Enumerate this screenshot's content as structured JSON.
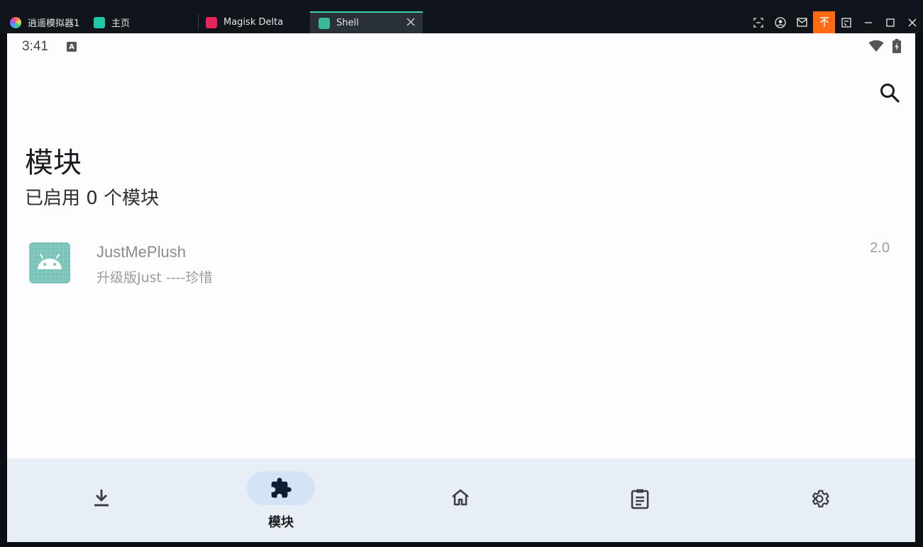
{
  "titlebar": {
    "tabs": [
      {
        "label": "逍遥模拟器1"
      },
      {
        "label": "主页"
      },
      {
        "label": "Magisk Delta"
      },
      {
        "label": "Shell"
      }
    ],
    "accent_color": "#ff6a13",
    "active_tab_color": "#39d3b0"
  },
  "status": {
    "time": "3:41",
    "badge": "A"
  },
  "page": {
    "title": "模块",
    "subtitle": "已启用 0 个模块"
  },
  "modules": [
    {
      "name": "JustMePlush",
      "description": "升级版Just  ----珍惜",
      "version": "2.0"
    }
  ],
  "nav": {
    "items": [
      {
        "icon": "download-icon",
        "label": ""
      },
      {
        "icon": "puzzle-icon",
        "label": "模块",
        "selected": true
      },
      {
        "icon": "home-icon",
        "label": ""
      },
      {
        "icon": "clipboard-icon",
        "label": ""
      },
      {
        "icon": "gear-icon",
        "label": ""
      }
    ]
  }
}
